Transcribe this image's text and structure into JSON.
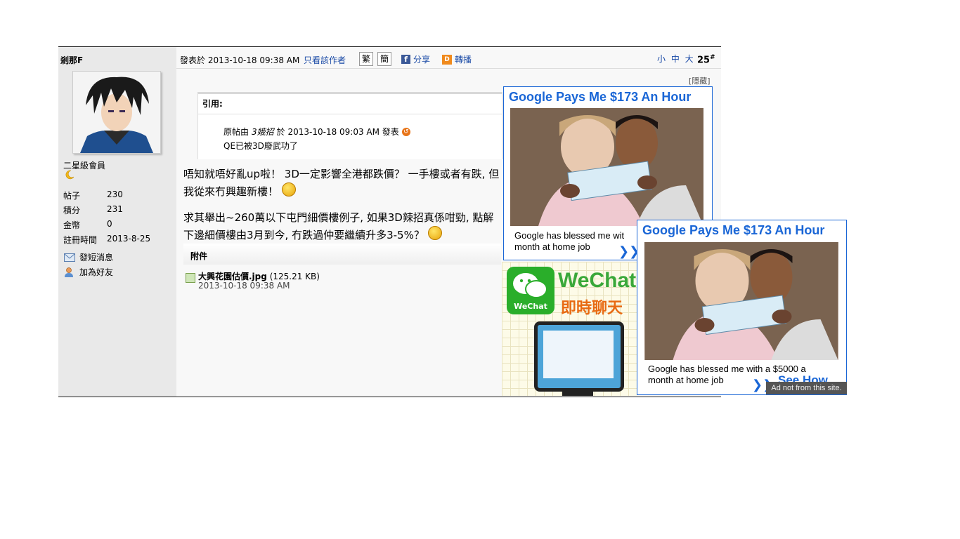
{
  "author": {
    "name": "剎那F",
    "rank": "二星級會員",
    "stats": [
      {
        "label": "帖子",
        "value": "230"
      },
      {
        "label": "積分",
        "value": "231"
      },
      {
        "label": "金幣",
        "value": "0"
      },
      {
        "label": "註冊時間",
        "value": "2013-8-25"
      }
    ],
    "actions": {
      "send_pm": "發短消息",
      "add_friend": "加為好友"
    }
  },
  "postinfo": {
    "posted_at": "發表於 2013-10-18 09:38 AM",
    "only_author": "只看該作者",
    "traditional": "繁",
    "simplified": "簡",
    "share": "分享",
    "forward": "轉播",
    "font_sizes": "小 中 大",
    "floor": "25",
    "floor_mark": "#"
  },
  "hide_label": "[隱藏]",
  "quote": {
    "header": "引用:",
    "origin_prefix": "原帖由",
    "origin_user": "3娥招",
    "origin_time": "於 2013-10-18 09:03 AM 發表",
    "text": "QE已被3D廢武功了"
  },
  "content": {
    "p1": "唔知就唔好亂up啦！ 3D一定影響全港都跌價？ 一手樓或者有跌, 但我從來冇興趣新樓！",
    "p2": "求其舉出~260萬以下屯門細價樓例子, 如果3D辣招真係咁勁, 點解下邊細價樓由3月到今, 冇跌過仲要繼續升多3-5%？"
  },
  "attachment": {
    "title": "附件",
    "file_name": "大興花園估價.jpg",
    "file_size": "(125.21 KB)",
    "time": "2013-10-18 09:38 AM"
  },
  "ads": {
    "title": "Google Pays Me $173 An Hour",
    "body_line1_ad1": "Google has blessed me wit",
    "body_line2": "month at home job",
    "body_line1_ad2": "Google has blessed me with a $5000 a",
    "see_how": "See How",
    "notice": "Ad not from this site.",
    "wechat_brand": "WeChat",
    "wechat_logo_label": "WeChat",
    "wechat_sub": "即時聊天"
  },
  "colors": {
    "link": "#1a4aa6",
    "ad_blue": "#1a66d6",
    "sidebar_bg": "#e9e9e9",
    "wechat_green": "#2aae2a",
    "wechat_orange": "#e86a12"
  }
}
